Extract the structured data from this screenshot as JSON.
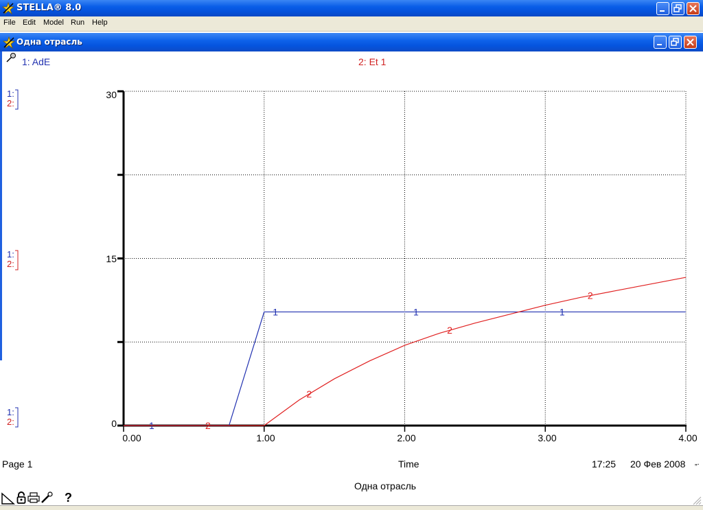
{
  "app": {
    "title": "STELLA® 8.0",
    "menu": [
      "File",
      "Edit",
      "Model",
      "Run",
      "Help"
    ]
  },
  "document": {
    "title": "Одна отрасль"
  },
  "legend": {
    "series1": "1: AdE",
    "series2": "2: Et 1"
  },
  "scale_labels": {
    "blue": "1:",
    "red": "2:"
  },
  "chart_data": {
    "type": "line",
    "xlabel": "Time",
    "xlim": [
      0,
      4
    ],
    "ylim": [
      0,
      30
    ],
    "x_ticks": [
      "0.00",
      "1.00",
      "2.00",
      "3.00",
      "4.00"
    ],
    "y_ticks": [
      "0",
      "15",
      "30"
    ],
    "grid": true,
    "colors": {
      "series1": "#2030b0",
      "series2": "#e02020"
    },
    "series": [
      {
        "name": "1: AdE",
        "marker": "1",
        "x": [
          0,
          0.75,
          1.0,
          4.0
        ],
        "y": [
          0,
          0,
          10.2,
          10.2
        ]
      },
      {
        "name": "2: Et 1",
        "marker": "2",
        "x": [
          0,
          1.0,
          1.25,
          1.5,
          1.75,
          2.0,
          2.25,
          2.5,
          2.75,
          3.0,
          3.25,
          3.5,
          3.75,
          4.0
        ],
        "y": [
          0,
          0,
          2.3,
          4.2,
          5.8,
          7.2,
          8.3,
          9.2,
          10.0,
          10.8,
          11.5,
          12.1,
          12.7,
          13.3
        ]
      }
    ]
  },
  "footer": {
    "page": "Page 1",
    "xlabel": "Time",
    "time": "17:25",
    "date": "20 Фев 2008",
    "date_suffix": "„.",
    "caption": "Одна отрасль"
  },
  "toolbar": {
    "help": "?"
  }
}
